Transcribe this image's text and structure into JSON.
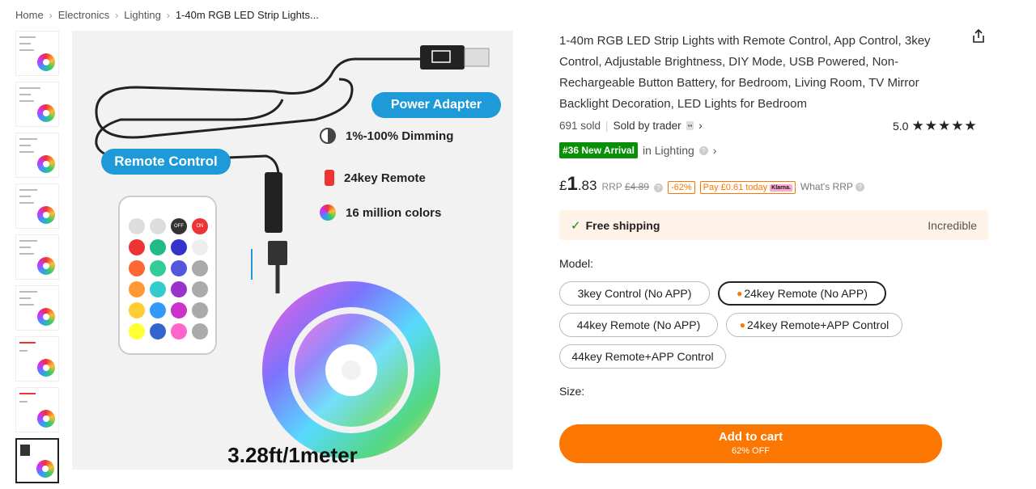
{
  "breadcrumb": [
    "Home",
    "Electronics",
    "Lighting",
    "1-40m RGB LED Strip Lights..."
  ],
  "image": {
    "remote_label": "Remote Control",
    "adapter_label": "Power Adapter",
    "features": [
      "1%-100% Dimming",
      "24key Remote",
      "16 million colors"
    ],
    "caption": "3.28ft/1meter",
    "remote_buttons_top": [
      "OFF",
      "ON"
    ]
  },
  "product": {
    "title": "1-40m RGB LED Strip Lights with Remote Control, App Control, 3key Control, Adjustable Brightness, DIY Mode, USB Powered, Non-Rechargeable Button Battery, for Bedroom, Living Room, TV Mirror Backlight Decoration, LED Lights for Bedroom",
    "sold": "691 sold",
    "sold_by": "Sold by trader",
    "rating": "5.0",
    "stars": "★★★★★",
    "rank_tag": "#36 New Arrival",
    "rank_cat": "in Lighting"
  },
  "pricing": {
    "currency": "£",
    "whole": "1",
    "fraction": ".83",
    "rrp_label": "RRP",
    "rrp": "£4.89",
    "discount": "-62%",
    "pay_today": "Pay £0.61 today",
    "klarna": "Klarna.",
    "whats_rrp": "What's RRP"
  },
  "shipping": {
    "label": "Free shipping",
    "note": "Incredible"
  },
  "model": {
    "label": "Model:",
    "options": [
      "3key Control (No APP)",
      "24key Remote (No APP)",
      "44key Remote (No APP)",
      "24key Remote+APP Control",
      "44key Remote+APP Control"
    ],
    "selected_index": 1
  },
  "size": {
    "label": "Size:"
  },
  "cart": {
    "label": "Add to cart",
    "sub": "62% OFF"
  },
  "colors": {
    "accent": "#fb7701",
    "green": "#0a8f08",
    "pill_blue": "#1e9ad9"
  }
}
